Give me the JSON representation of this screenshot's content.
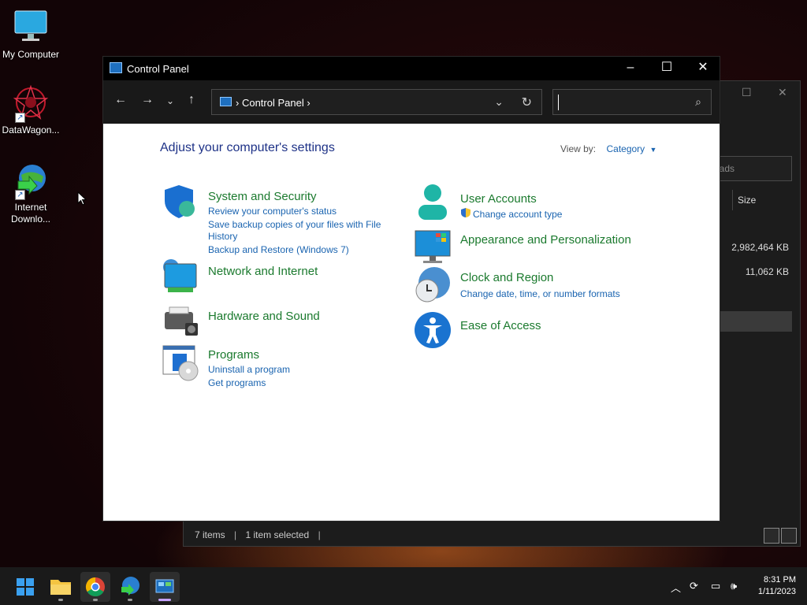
{
  "desktop": {
    "icons": [
      {
        "label": "My Computer"
      },
      {
        "label": "DataWagon..."
      },
      {
        "label": "Internet Downlo..."
      }
    ]
  },
  "background_window": {
    "search_placeholder": "oads",
    "column_header": "Size",
    "sizes": [
      "2,982,464 KB",
      "11,062 KB"
    ],
    "status": {
      "items": "7 items",
      "selected": "1 item selected"
    }
  },
  "control_panel": {
    "title": "Control Panel",
    "address": "Control Panel",
    "heading": "Adjust your computer's settings",
    "view_by_label": "View by:",
    "view_by_value": "Category",
    "left_categories": [
      {
        "title": "System and Security",
        "links": [
          "Review your computer's status",
          "Save backup copies of your files with File",
          "History",
          "Backup and Restore (Windows 7)"
        ],
        "icon": "shield-icon"
      },
      {
        "title": "Network and Internet",
        "links": [],
        "icon": "network-icon"
      },
      {
        "title": "Hardware and Sound",
        "links": [],
        "icon": "printer-icon"
      },
      {
        "title": "Programs",
        "links": [
          "Uninstall a program",
          "Get programs"
        ],
        "icon": "programs-icon"
      }
    ],
    "right_categories": [
      {
        "title": "User Accounts",
        "links": [
          "Change account type"
        ],
        "icon": "user-icon"
      },
      {
        "title": "Appearance and Personalization",
        "links": [],
        "icon": "monitor-icon"
      },
      {
        "title": "Clock and Region",
        "links": [
          "Change date, time, or number formats"
        ],
        "icon": "clock-globe-icon"
      },
      {
        "title": "Ease of Access",
        "links": [],
        "icon": "accessibility-icon"
      }
    ]
  },
  "taskbar": {
    "time": "8:31 PM",
    "date": "1/11/2023"
  },
  "colors": {
    "category_title": "#1b7a2e",
    "link": "#1a64b0",
    "heading": "#1e3287"
  }
}
